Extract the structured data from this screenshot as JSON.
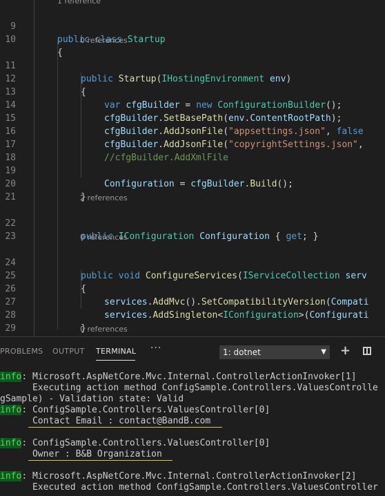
{
  "editor": {
    "top_lens": "1 reference",
    "lines": {
      "l9": {
        "num": "9",
        "kw": "public class",
        "ty": "Startup"
      },
      "l10": {
        "num": "10",
        "brace": "{"
      },
      "lens11": "0 references",
      "l11": {
        "num": "11",
        "kw": "public",
        "fn": "Startup",
        "p1": "(",
        "ty": "IHostingEnvironment",
        "id": "env",
        "p2": ")"
      },
      "l12": {
        "num": "12",
        "brace": "{"
      },
      "l13": {
        "num": "13",
        "kw": "var",
        "id": "cfgBuilder",
        "p1": " = ",
        "kw2": "new",
        "ty": "ConfigurationBuilder",
        "p2": "();"
      },
      "l14": {
        "num": "14",
        "id": "cfgBuilder",
        "p1": ".",
        "fn": "SetBasePath",
        "p2": "(",
        "id2": "env",
        "p3": ".",
        "id3": "ContentRootPath",
        "p4": ");"
      },
      "l15": {
        "num": "15",
        "id": "cfgBuilder",
        "p1": ".",
        "fn": "AddJsonFile",
        "p2": "(",
        "str": "\"appsettings.json\"",
        "p3": ", ",
        "kw": "false"
      },
      "l16": {
        "num": "16",
        "id": "cfgBuilder",
        "p1": ".",
        "fn": "AddJsonFile",
        "p2": "(",
        "str": "\"copyrightSettings.json\"",
        "p3": ","
      },
      "l17": {
        "num": "17",
        "cm": "//cfgBuilder.AddXmlFile"
      },
      "l18": {
        "num": "18"
      },
      "l19": {
        "num": "19",
        "id": "Configuration",
        "p1": " = ",
        "id2": "cfgBuilder",
        "p2": ".",
        "fn": "Build",
        "p3": "();"
      },
      "l20": {
        "num": "20",
        "brace": "}"
      },
      "l21": {
        "num": "21"
      },
      "lens22": "2 references",
      "l22": {
        "num": "22",
        "kw": "public",
        "ty": "IConfiguration",
        "id": "Configuration",
        "p1": " { ",
        "kw2": "get",
        "p2": "; }"
      },
      "l23": {
        "num": "23"
      },
      "lens24": "0 references",
      "l24": {
        "num": "24",
        "kw": "public void",
        "fn": "ConfigureServices",
        "p1": "(",
        "ty": "IServiceCollection",
        "id": "serv"
      },
      "l25": {
        "num": "25",
        "brace": "{"
      },
      "l26": {
        "num": "26",
        "id": "services",
        "p1": ".",
        "fn": "AddMvc",
        "p2": "().",
        "fn2": "SetCompatibilityVersion",
        "p3": "(",
        "id2": "Compati"
      },
      "l27": {
        "num": "27",
        "id": "services",
        "p1": ".",
        "fn": "AddSingleton",
        "p2": "<",
        "ty": "IConfiguration",
        "p3": ">(",
        "id2": "Configurati"
      },
      "l28": {
        "num": "28",
        "brace": "}"
      },
      "l29": {
        "num": "29"
      },
      "lens30": "0 references"
    }
  },
  "panel": {
    "tabs": [
      "PROBLEMS",
      "OUTPUT",
      "TERMINAL"
    ],
    "more_label": "···",
    "terminal_select": "1: dotnet",
    "select_arrow": "▼",
    "plus_label": "+"
  },
  "terminal": {
    "info_label": "info",
    "t1": ": Microsoft.AspNetCore.Mvc.Internal.ControllerActionInvoker[1]",
    "t2": "      Executing action method ConfigSample.Controllers.ValuesControlle",
    "t3": "gSample) - Validation state: Valid",
    "t4": ": ConfigSample.Controllers.ValuesController[0]",
    "t5": "      Contact Email : contact@BandB.com",
    "t6": ": ConfigSample.Controllers.ValuesController[0]",
    "t7": "      Owner : B&B Organization",
    "t8": ": Microsoft.AspNetCore.Mvc.Internal.ControllerActionInvoker[2]",
    "t9": "      Executed action method ConfigSample.Controllers.ValuesController"
  },
  "colors": {
    "keyword": "#569cd6",
    "type": "#4ec9b0",
    "function": "#dcdcaa",
    "identifier": "#9cdcfe",
    "string": "#ce9178",
    "comment": "#6a9955",
    "highlight_underline": "#d7c84a"
  }
}
